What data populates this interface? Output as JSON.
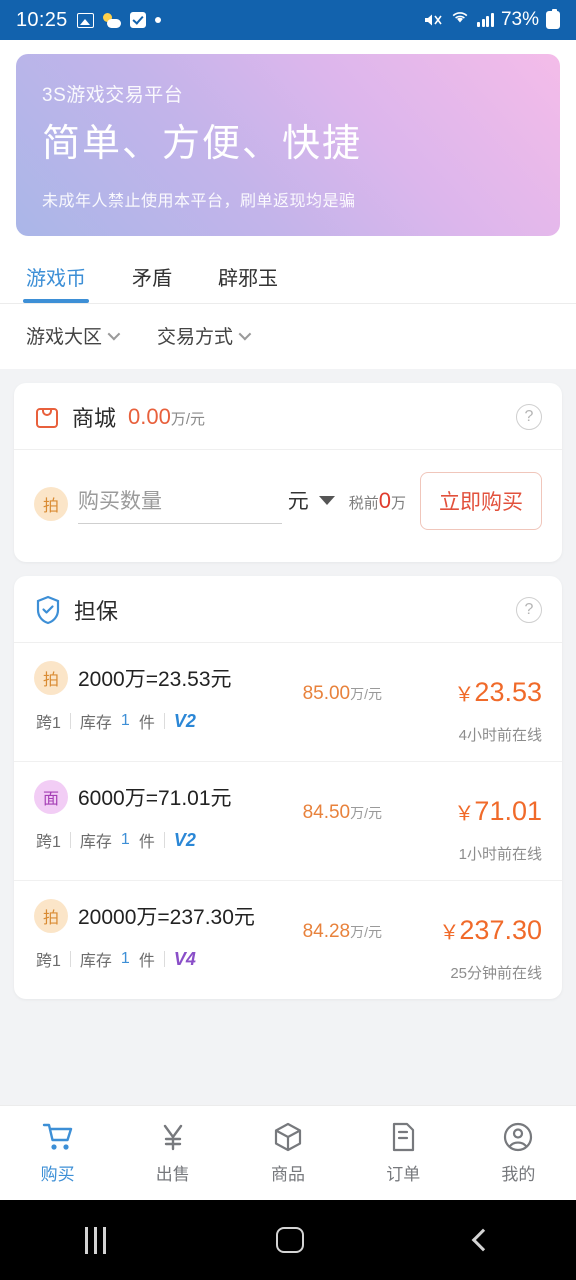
{
  "status_bar": {
    "time": "10:25",
    "battery_percent": "73%",
    "left_icons": [
      "gallery-icon",
      "weather-icon",
      "checkbox-icon",
      "dot-icon"
    ],
    "right_icons": [
      "mute-icon",
      "wifi-icon",
      "signal-icon",
      "battery-icon"
    ],
    "background_color": "#1262ad"
  },
  "banner": {
    "brand": "3S游戏交易平台",
    "title": "简单、方便、快捷",
    "note": "未成年人禁止使用本平台，刷单返现均是骗",
    "gradient_from": "#aab6e8",
    "gradient_to": "#f4bce9"
  },
  "tabs": [
    {
      "label": "游戏币",
      "active": true
    },
    {
      "label": "矛盾",
      "active": false
    },
    {
      "label": "辟邪玉",
      "active": false
    }
  ],
  "filters": [
    {
      "label": "游戏大区"
    },
    {
      "label": "交易方式"
    }
  ],
  "mall_card": {
    "icon": "shopping-bag-icon",
    "title": "商城",
    "rate": "0.00",
    "rate_unit": "万/元",
    "help": "?",
    "buy_row": {
      "badge": "拍",
      "qty_placeholder": "购买数量",
      "unit": "元",
      "tax_label": "税前",
      "tax_value": "0",
      "tax_unit": "万",
      "button": "立即购买"
    }
  },
  "guarantee_card": {
    "icon": "shield-check-icon",
    "title": "担保",
    "help": "?",
    "listings": [
      {
        "badge": "拍",
        "badge_type": "pai",
        "name": "2000万=23.53元",
        "region": "跨1",
        "stock_label": "库存",
        "stock_num": "1",
        "stock_unit": "件",
        "vip": "V2",
        "vip_level": "v2",
        "rate": "85.00",
        "rate_unit": "万/元",
        "price": "￥",
        "price_value": "23.53",
        "online": "4小时前在线"
      },
      {
        "badge": "面",
        "badge_type": "mian",
        "name": "6000万=71.01元",
        "region": "跨1",
        "stock_label": "库存",
        "stock_num": "1",
        "stock_unit": "件",
        "vip": "V2",
        "vip_level": "v2",
        "rate": "84.50",
        "rate_unit": "万/元",
        "price": "￥",
        "price_value": "71.01",
        "online": "1小时前在线"
      },
      {
        "badge": "拍",
        "badge_type": "pai",
        "name": "20000万=237.30元",
        "region": "跨1",
        "stock_label": "库存",
        "stock_num": "1",
        "stock_unit": "件",
        "vip": "V4",
        "vip_level": "v4",
        "rate": "84.28",
        "rate_unit": "万/元",
        "price": "￥",
        "price_value": "237.30",
        "online": "25分钟前在线"
      }
    ]
  },
  "bottom_nav": [
    {
      "label": "购买",
      "icon": "cart-icon",
      "active": true
    },
    {
      "label": "出售",
      "icon": "yen-icon",
      "active": false
    },
    {
      "label": "商品",
      "icon": "box-icon",
      "active": false
    },
    {
      "label": "订单",
      "icon": "order-document-icon",
      "active": false
    },
    {
      "label": "我的",
      "icon": "user-account-icon",
      "active": false
    }
  ],
  "android_nav": [
    "recents-icon",
    "home-icon",
    "back-icon"
  ],
  "colors": {
    "accent_blue": "#3d8fd6",
    "accent_orange": "#f06a2a",
    "accent_red": "#e2513c"
  }
}
